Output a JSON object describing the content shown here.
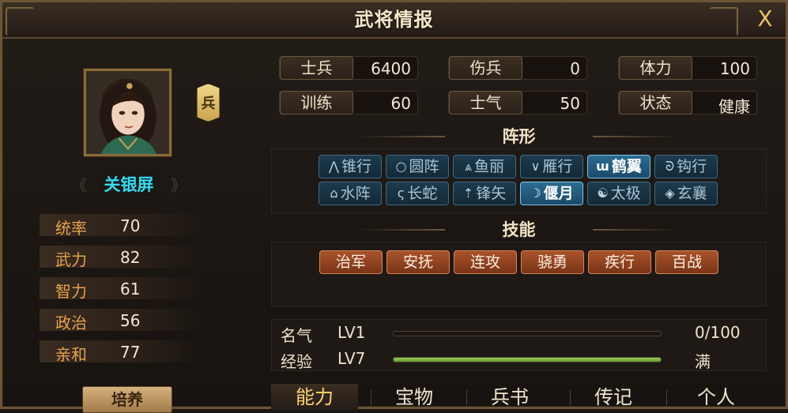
{
  "window": {
    "title": "武将情报",
    "close_label": "X"
  },
  "general": {
    "name": "关银屏",
    "troop_type_badge": "兵",
    "stats": [
      {
        "label": "统率",
        "value": "70"
      },
      {
        "label": "武力",
        "value": "82"
      },
      {
        "label": "智力",
        "value": "61"
      },
      {
        "label": "政治",
        "value": "56"
      },
      {
        "label": "亲和",
        "value": "77"
      }
    ],
    "cultivate_label": "培养"
  },
  "info": [
    {
      "label": "士兵",
      "value": "6400"
    },
    {
      "label": "伤兵",
      "value": "0"
    },
    {
      "label": "体力",
      "value": "100"
    },
    {
      "label": "训练",
      "value": "60"
    },
    {
      "label": "士气",
      "value": "50"
    },
    {
      "label": "状态",
      "value": "健康"
    }
  ],
  "formation": {
    "title": "阵形",
    "items": [
      {
        "icon": "arrow-up-icon",
        "glyph": "⋀",
        "label": "锥行",
        "active": false
      },
      {
        "icon": "circle-icon",
        "glyph": "○",
        "label": "圆阵",
        "active": false
      },
      {
        "icon": "fish-scale-icon",
        "glyph": "⩓",
        "label": "鱼丽",
        "active": false
      },
      {
        "icon": "v-shape-icon",
        "glyph": "∨",
        "label": "雁行",
        "active": false
      },
      {
        "icon": "wing-icon",
        "glyph": "ɯ",
        "label": "鹤翼",
        "active": true
      },
      {
        "icon": "hook-icon",
        "glyph": "ᘐ",
        "label": "钩行",
        "active": false
      },
      {
        "icon": "water-icon",
        "glyph": "⌂",
        "label": "水阵",
        "active": false
      },
      {
        "icon": "snake-icon",
        "glyph": "ς",
        "label": "长蛇",
        "active": false
      },
      {
        "icon": "arrowhead-icon",
        "glyph": "⇡",
        "label": "锋矢",
        "active": false
      },
      {
        "icon": "crescent-icon",
        "glyph": "☽",
        "label": "偃月",
        "active": true
      },
      {
        "icon": "taiji-icon",
        "glyph": "☯",
        "label": "太极",
        "active": false
      },
      {
        "icon": "diamond-icon",
        "glyph": "◈",
        "label": "玄襄",
        "active": false
      }
    ]
  },
  "skills": {
    "title": "技能",
    "items": [
      "治军",
      "安抚",
      "连攻",
      "骁勇",
      "疾行",
      "百战"
    ]
  },
  "progress": [
    {
      "label": "名气",
      "level": "LV1",
      "value_text": "0/100",
      "fraction": 0.0
    },
    {
      "label": "经验",
      "level": "LV7",
      "value_text": "满",
      "fraction": 1.0
    }
  ],
  "tabs": [
    {
      "label": "能力",
      "active": true
    },
    {
      "label": "宝物",
      "active": false
    },
    {
      "label": "兵书",
      "active": false
    },
    {
      "label": "传记",
      "active": false
    },
    {
      "label": "个人",
      "active": false
    }
  ],
  "colors": {
    "name": "#34dcef",
    "stat_label": "#e7a24a",
    "formation_active": "#2c6c92",
    "skill": "#a8532a",
    "exp_bar": "#7cb646"
  }
}
